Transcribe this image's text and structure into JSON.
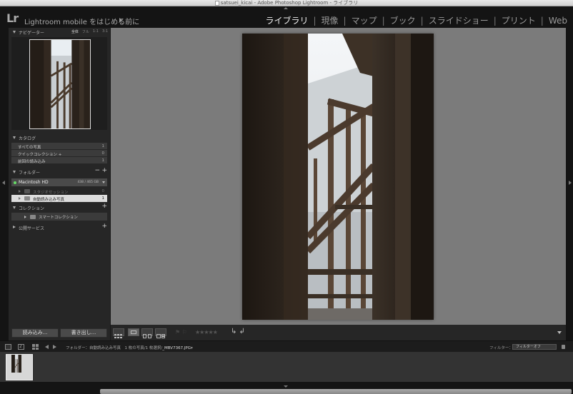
{
  "window": {
    "title": "satsuei_kicai - Adobe Photoshop Lightroom - ライブラリ"
  },
  "topbar": {
    "logo": "Lr",
    "identity": "Lightroom mobile をはじめる前に",
    "modules": [
      {
        "label": "ライブラリ",
        "active": true
      },
      {
        "label": "現像",
        "active": false
      },
      {
        "label": "マップ",
        "active": false
      },
      {
        "label": "ブック",
        "active": false
      },
      {
        "label": "スライドショー",
        "active": false
      },
      {
        "label": "プリント",
        "active": false
      },
      {
        "label": "Web",
        "active": false
      }
    ],
    "separator": "|"
  },
  "navigator": {
    "title": "ナビゲーター",
    "zooms": [
      {
        "label": "全体",
        "active": true
      },
      {
        "label": "フル",
        "active": false
      },
      {
        "label": "1:1",
        "active": false
      },
      {
        "label": "3:1",
        "active": false
      }
    ]
  },
  "catalog": {
    "title": "カタログ",
    "items": [
      {
        "name": "すべての写真",
        "count": "1"
      },
      {
        "name": "クイックコレクション +",
        "count": "0"
      },
      {
        "name": "前回の読み込み",
        "count": "1"
      }
    ]
  },
  "folders": {
    "title": "フォルダー",
    "minus": "−",
    "plus": "+",
    "volume": {
      "name": "Macintosh HD",
      "size": "438 / 465 GB"
    },
    "items": [
      {
        "name": "スタジオセッション",
        "count": "0"
      },
      {
        "name": "自動読み込み写真",
        "count": "1"
      }
    ]
  },
  "collections": {
    "title": "コレクション",
    "plus": "+",
    "items": [
      {
        "name": "スマートコレクション"
      }
    ]
  },
  "publish": {
    "title": "公開サービス",
    "plus": "+"
  },
  "left_buttons": {
    "import": "読み込み...",
    "export": "書き出し..."
  },
  "toolbar": {
    "stars": "★★★★★",
    "flags": "⚑ ⚐",
    "rotate": "↳ ↲"
  },
  "filmbar": {
    "second_window": "2",
    "path_prefix": "フォルダー：自動読み込み写真　1 枚の写真/1 枚選択/",
    "file": "_MBV7367.JPG",
    "file_dd": "▾",
    "filter_label": "フィルター：",
    "filter_value": "フィルターオフ"
  }
}
